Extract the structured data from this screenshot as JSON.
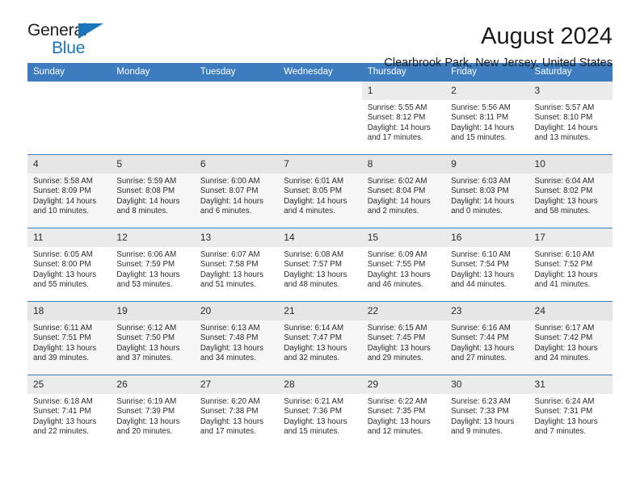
{
  "brand": {
    "name_part1": "General",
    "name_part2": "Blue",
    "accent_color": "#1b75bb",
    "triangle_icon": "triangle-icon"
  },
  "header": {
    "title": "August 2024",
    "subtitle": "Clearbrook Park, New Jersey, United States"
  },
  "calendar": {
    "header_background": "#3c7cbf",
    "weekday_headers": [
      "Sunday",
      "Monday",
      "Tuesday",
      "Wednesday",
      "Thursday",
      "Friday",
      "Saturday"
    ],
    "weeks": [
      [
        {
          "day": "",
          "sunrise": "",
          "sunset": "",
          "daylight": "",
          "daylight2": ""
        },
        {
          "day": "",
          "sunrise": "",
          "sunset": "",
          "daylight": "",
          "daylight2": ""
        },
        {
          "day": "",
          "sunrise": "",
          "sunset": "",
          "daylight": "",
          "daylight2": ""
        },
        {
          "day": "",
          "sunrise": "",
          "sunset": "",
          "daylight": "",
          "daylight2": ""
        },
        {
          "day": "1",
          "sunrise": "Sunrise: 5:55 AM",
          "sunset": "Sunset: 8:12 PM",
          "daylight": "Daylight: 14 hours",
          "daylight2": "and 17 minutes."
        },
        {
          "day": "2",
          "sunrise": "Sunrise: 5:56 AM",
          "sunset": "Sunset: 8:11 PM",
          "daylight": "Daylight: 14 hours",
          "daylight2": "and 15 minutes."
        },
        {
          "day": "3",
          "sunrise": "Sunrise: 5:57 AM",
          "sunset": "Sunset: 8:10 PM",
          "daylight": "Daylight: 14 hours",
          "daylight2": "and 13 minutes."
        }
      ],
      [
        {
          "day": "4",
          "sunrise": "Sunrise: 5:58 AM",
          "sunset": "Sunset: 8:09 PM",
          "daylight": "Daylight: 14 hours",
          "daylight2": "and 10 minutes."
        },
        {
          "day": "5",
          "sunrise": "Sunrise: 5:59 AM",
          "sunset": "Sunset: 8:08 PM",
          "daylight": "Daylight: 14 hours",
          "daylight2": "and 8 minutes."
        },
        {
          "day": "6",
          "sunrise": "Sunrise: 6:00 AM",
          "sunset": "Sunset: 8:07 PM",
          "daylight": "Daylight: 14 hours",
          "daylight2": "and 6 minutes."
        },
        {
          "day": "7",
          "sunrise": "Sunrise: 6:01 AM",
          "sunset": "Sunset: 8:05 PM",
          "daylight": "Daylight: 14 hours",
          "daylight2": "and 4 minutes."
        },
        {
          "day": "8",
          "sunrise": "Sunrise: 6:02 AM",
          "sunset": "Sunset: 8:04 PM",
          "daylight": "Daylight: 14 hours",
          "daylight2": "and 2 minutes."
        },
        {
          "day": "9",
          "sunrise": "Sunrise: 6:03 AM",
          "sunset": "Sunset: 8:03 PM",
          "daylight": "Daylight: 14 hours",
          "daylight2": "and 0 minutes."
        },
        {
          "day": "10",
          "sunrise": "Sunrise: 6:04 AM",
          "sunset": "Sunset: 8:02 PM",
          "daylight": "Daylight: 13 hours",
          "daylight2": "and 58 minutes."
        }
      ],
      [
        {
          "day": "11",
          "sunrise": "Sunrise: 6:05 AM",
          "sunset": "Sunset: 8:00 PM",
          "daylight": "Daylight: 13 hours",
          "daylight2": "and 55 minutes."
        },
        {
          "day": "12",
          "sunrise": "Sunrise: 6:06 AM",
          "sunset": "Sunset: 7:59 PM",
          "daylight": "Daylight: 13 hours",
          "daylight2": "and 53 minutes."
        },
        {
          "day": "13",
          "sunrise": "Sunrise: 6:07 AM",
          "sunset": "Sunset: 7:58 PM",
          "daylight": "Daylight: 13 hours",
          "daylight2": "and 51 minutes."
        },
        {
          "day": "14",
          "sunrise": "Sunrise: 6:08 AM",
          "sunset": "Sunset: 7:57 PM",
          "daylight": "Daylight: 13 hours",
          "daylight2": "and 48 minutes."
        },
        {
          "day": "15",
          "sunrise": "Sunrise: 6:09 AM",
          "sunset": "Sunset: 7:55 PM",
          "daylight": "Daylight: 13 hours",
          "daylight2": "and 46 minutes."
        },
        {
          "day": "16",
          "sunrise": "Sunrise: 6:10 AM",
          "sunset": "Sunset: 7:54 PM",
          "daylight": "Daylight: 13 hours",
          "daylight2": "and 44 minutes."
        },
        {
          "day": "17",
          "sunrise": "Sunrise: 6:10 AM",
          "sunset": "Sunset: 7:52 PM",
          "daylight": "Daylight: 13 hours",
          "daylight2": "and 41 minutes."
        }
      ],
      [
        {
          "day": "18",
          "sunrise": "Sunrise: 6:11 AM",
          "sunset": "Sunset: 7:51 PM",
          "daylight": "Daylight: 13 hours",
          "daylight2": "and 39 minutes."
        },
        {
          "day": "19",
          "sunrise": "Sunrise: 6:12 AM",
          "sunset": "Sunset: 7:50 PM",
          "daylight": "Daylight: 13 hours",
          "daylight2": "and 37 minutes."
        },
        {
          "day": "20",
          "sunrise": "Sunrise: 6:13 AM",
          "sunset": "Sunset: 7:48 PM",
          "daylight": "Daylight: 13 hours",
          "daylight2": "and 34 minutes."
        },
        {
          "day": "21",
          "sunrise": "Sunrise: 6:14 AM",
          "sunset": "Sunset: 7:47 PM",
          "daylight": "Daylight: 13 hours",
          "daylight2": "and 32 minutes."
        },
        {
          "day": "22",
          "sunrise": "Sunrise: 6:15 AM",
          "sunset": "Sunset: 7:45 PM",
          "daylight": "Daylight: 13 hours",
          "daylight2": "and 29 minutes."
        },
        {
          "day": "23",
          "sunrise": "Sunrise: 6:16 AM",
          "sunset": "Sunset: 7:44 PM",
          "daylight": "Daylight: 13 hours",
          "daylight2": "and 27 minutes."
        },
        {
          "day": "24",
          "sunrise": "Sunrise: 6:17 AM",
          "sunset": "Sunset: 7:42 PM",
          "daylight": "Daylight: 13 hours",
          "daylight2": "and 24 minutes."
        }
      ],
      [
        {
          "day": "25",
          "sunrise": "Sunrise: 6:18 AM",
          "sunset": "Sunset: 7:41 PM",
          "daylight": "Daylight: 13 hours",
          "daylight2": "and 22 minutes."
        },
        {
          "day": "26",
          "sunrise": "Sunrise: 6:19 AM",
          "sunset": "Sunset: 7:39 PM",
          "daylight": "Daylight: 13 hours",
          "daylight2": "and 20 minutes."
        },
        {
          "day": "27",
          "sunrise": "Sunrise: 6:20 AM",
          "sunset": "Sunset: 7:38 PM",
          "daylight": "Daylight: 13 hours",
          "daylight2": "and 17 minutes."
        },
        {
          "day": "28",
          "sunrise": "Sunrise: 6:21 AM",
          "sunset": "Sunset: 7:36 PM",
          "daylight": "Daylight: 13 hours",
          "daylight2": "and 15 minutes."
        },
        {
          "day": "29",
          "sunrise": "Sunrise: 6:22 AM",
          "sunset": "Sunset: 7:35 PM",
          "daylight": "Daylight: 13 hours",
          "daylight2": "and 12 minutes."
        },
        {
          "day": "30",
          "sunrise": "Sunrise: 6:23 AM",
          "sunset": "Sunset: 7:33 PM",
          "daylight": "Daylight: 13 hours",
          "daylight2": "and 9 minutes."
        },
        {
          "day": "31",
          "sunrise": "Sunrise: 6:24 AM",
          "sunset": "Sunset: 7:31 PM",
          "daylight": "Daylight: 13 hours",
          "daylight2": "and 7 minutes."
        }
      ]
    ]
  }
}
